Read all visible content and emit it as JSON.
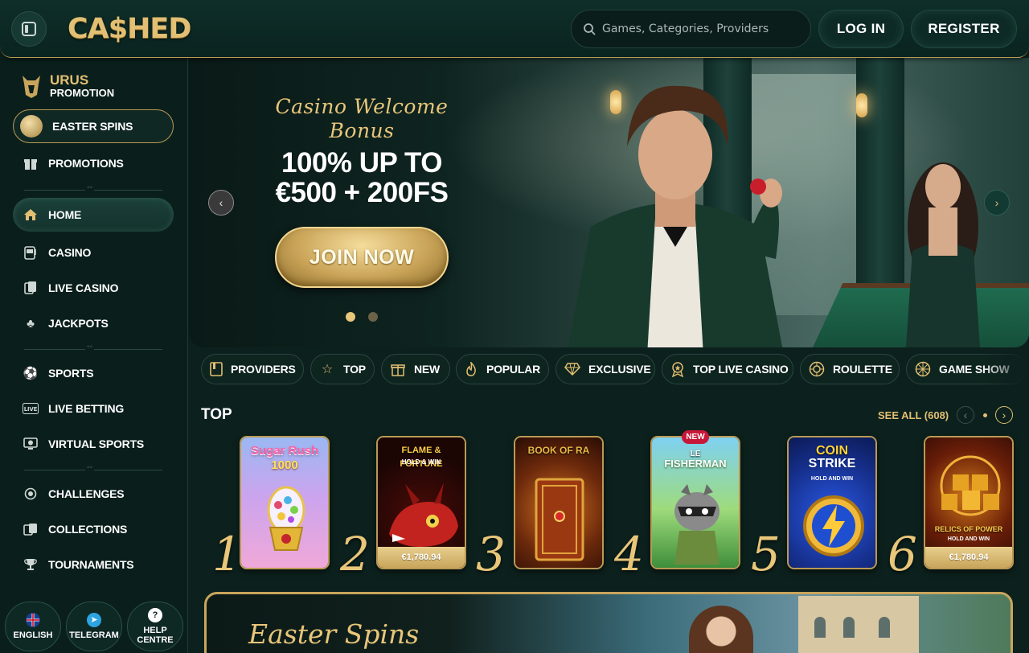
{
  "header": {
    "logo_text": "CA$HED",
    "search_placeholder": "Games, Categories, Providers",
    "login_label": "LOG IN",
    "register_label": "REGISTER"
  },
  "sidebar": {
    "urus_title": "URUS",
    "urus_subtitle": "PROMOTION",
    "items": [
      {
        "label": "EASTER SPINS",
        "icon": "easter-coin-icon"
      },
      {
        "label": "PROMOTIONS",
        "icon": "gift-icon"
      },
      {
        "label": "HOME",
        "icon": "home-icon"
      },
      {
        "label": "CASINO",
        "icon": "slot-machine-icon"
      },
      {
        "label": "LIVE CASINO",
        "icon": "cards-icon"
      },
      {
        "label": "JACKPOTS",
        "icon": "clover-icon"
      },
      {
        "label": "SPORTS",
        "icon": "soccer-ball-icon"
      },
      {
        "label": "LIVE BETTING",
        "icon": "live-icon"
      },
      {
        "label": "VIRTUAL SPORTS",
        "icon": "virtual-sports-icon"
      },
      {
        "label": "CHALLENGES",
        "icon": "challenge-medal-icon"
      },
      {
        "label": "COLLECTIONS",
        "icon": "collections-icon"
      },
      {
        "label": "TOURNAMENTS",
        "icon": "trophy-icon"
      }
    ],
    "bottom": {
      "english_label": "ENGLISH",
      "telegram_label": "TELEGRAM",
      "help_label_1": "HELP",
      "help_label_2": "CENTRE"
    }
  },
  "hero": {
    "script_line_1": "Casino Welcome",
    "script_line_2": "Bonus",
    "headline_1": "100% UP TO",
    "headline_2": "€500 + 200FS",
    "cta": "JOIN NOW",
    "slide_count": 2,
    "active_slide": 1
  },
  "categories": [
    {
      "label": "PROVIDERS",
      "icon": "providers-icon"
    },
    {
      "label": "TOP",
      "icon": "star-icon"
    },
    {
      "label": "NEW",
      "icon": "new-gift-icon"
    },
    {
      "label": "POPULAR",
      "icon": "flame-icon"
    },
    {
      "label": "EXCLUSIVE",
      "icon": "diamond-icon"
    },
    {
      "label": "TOP LIVE CASINO",
      "icon": "badge-icon"
    },
    {
      "label": "ROULETTE",
      "icon": "roulette-icon"
    },
    {
      "label": "GAME SHOW",
      "icon": "game-show-icon"
    }
  ],
  "top_section": {
    "title": "TOP",
    "see_all": "SEE ALL (608)",
    "games": [
      {
        "rank": "1",
        "title_1": "Sugar Rush",
        "title_2": "1000",
        "jackpot": ""
      },
      {
        "rank": "2",
        "title_1": "FLAME & FORTUNE",
        "title_2": "HOLD & WIN",
        "jackpot": "€1,780.94"
      },
      {
        "rank": "3",
        "title_1": "BOOK OF RA",
        "title_2": "",
        "jackpot": ""
      },
      {
        "rank": "4",
        "title_1": "LE",
        "title_2": "FISHERMAN",
        "jackpot": "",
        "badge": "NEW"
      },
      {
        "rank": "5",
        "title_1": "COIN",
        "title_2": "STRIKE",
        "title_3": "HOLD AND WIN",
        "jackpot": ""
      },
      {
        "rank": "6",
        "title_1": "RELICS OF POWER",
        "title_2": "HOLD AND WIN",
        "jackpot": "€1,780.94"
      }
    ]
  },
  "promo_banner": {
    "script": "Easter Spins"
  }
}
